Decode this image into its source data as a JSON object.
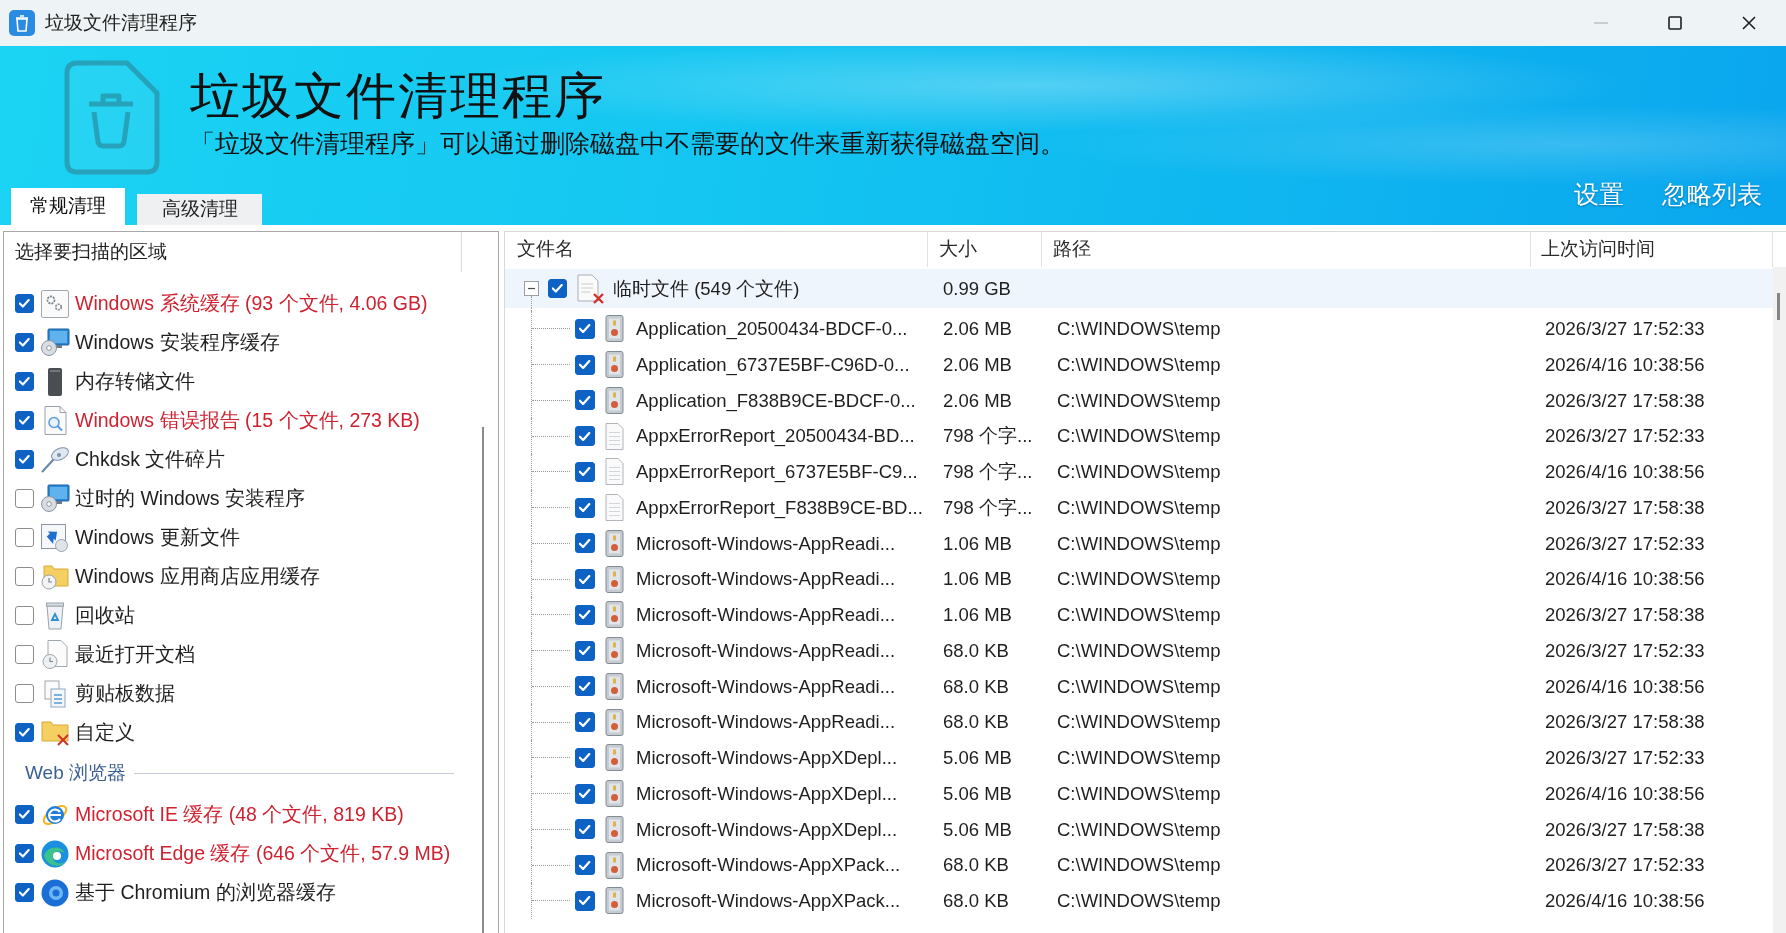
{
  "window": {
    "title": "垃圾文件清理程序"
  },
  "banner": {
    "title": "垃圾文件清理程序",
    "subtitle": "「垃圾文件清理程序」可以通过删除磁盘中不需要的文件来重新获得磁盘空间。"
  },
  "tabs": [
    {
      "label": "常规清理",
      "selected": true
    },
    {
      "label": "高级清理",
      "selected": false
    }
  ],
  "links": [
    "设置",
    "忽略列表"
  ],
  "scan_areas": {
    "header": "选择要扫描的区域",
    "sections": [
      {
        "items": [
          {
            "label": "Windows 系统缓存 (93 个文件, 4.06 GB)",
            "checked": true,
            "has_results": true
          },
          {
            "label": "Windows 安装程序缓存",
            "checked": true,
            "has_results": false
          },
          {
            "label": "内存转储文件",
            "checked": true,
            "has_results": false
          },
          {
            "label": "Windows 错误报告 (15 个文件, 273 KB)",
            "checked": true,
            "has_results": true
          },
          {
            "label": "Chkdsk 文件碎片",
            "checked": true,
            "has_results": false
          },
          {
            "label": "过时的 Windows 安装程序",
            "checked": false,
            "has_results": false
          },
          {
            "label": "Windows 更新文件",
            "checked": false,
            "has_results": false
          },
          {
            "label": "Windows 应用商店应用缓存",
            "checked": false,
            "has_results": false
          },
          {
            "label": "回收站",
            "checked": false,
            "has_results": false
          },
          {
            "label": "最近打开文档",
            "checked": false,
            "has_results": false
          },
          {
            "label": "剪贴板数据",
            "checked": false,
            "has_results": false
          },
          {
            "label": "自定义",
            "checked": true,
            "has_results": false
          }
        ]
      },
      {
        "title": "Web 浏览器",
        "items": [
          {
            "label": "Microsoft IE 缓存 (48 个文件, 819 KB)",
            "checked": true,
            "has_results": true
          },
          {
            "label": "Microsoft Edge 缓存 (646 个文件, 57.9 MB)",
            "checked": true,
            "has_results": true
          },
          {
            "label": "基于 Chromium 的浏览器缓存",
            "checked": true,
            "has_results": false
          }
        ]
      }
    ]
  },
  "file_table": {
    "columns": [
      "文件名",
      "大小",
      "路径",
      "上次访问时间"
    ],
    "groups": [
      {
        "name": "临时文件 (549 个文件)",
        "size": "0.99 GB",
        "checked": true,
        "expanded": true,
        "selected": true,
        "rows": [
          {
            "kind": "binary",
            "checked": true,
            "name": "Application_20500434-BDCF-0...",
            "size": "2.06 MB",
            "path": "C:\\WINDOWS\\temp",
            "accessed": "2026/3/27 17:52:33"
          },
          {
            "kind": "binary",
            "checked": true,
            "name": "Application_6737E5BF-C96D-0...",
            "size": "2.06 MB",
            "path": "C:\\WINDOWS\\temp",
            "accessed": "2026/4/16 10:38:56"
          },
          {
            "kind": "binary",
            "checked": true,
            "name": "Application_F838B9CE-BDCF-0...",
            "size": "2.06 MB",
            "path": "C:\\WINDOWS\\temp",
            "accessed": "2026/3/27 17:58:38"
          },
          {
            "kind": "text",
            "checked": true,
            "name": "AppxErrorReport_20500434-BD...",
            "size": "798 个字...",
            "path": "C:\\WINDOWS\\temp",
            "accessed": "2026/3/27 17:52:33"
          },
          {
            "kind": "text",
            "checked": true,
            "name": "AppxErrorReport_6737E5BF-C9...",
            "size": "798 个字...",
            "path": "C:\\WINDOWS\\temp",
            "accessed": "2026/4/16 10:38:56"
          },
          {
            "kind": "text",
            "checked": true,
            "name": "AppxErrorReport_F838B9CE-BD...",
            "size": "798 个字...",
            "path": "C:\\WINDOWS\\temp",
            "accessed": "2026/3/27 17:58:38"
          },
          {
            "kind": "binary",
            "checked": true,
            "name": "Microsoft-Windows-AppReadi...",
            "size": "1.06 MB",
            "path": "C:\\WINDOWS\\temp",
            "accessed": "2026/3/27 17:52:33"
          },
          {
            "kind": "binary",
            "checked": true,
            "name": "Microsoft-Windows-AppReadi...",
            "size": "1.06 MB",
            "path": "C:\\WINDOWS\\temp",
            "accessed": "2026/4/16 10:38:56"
          },
          {
            "kind": "binary",
            "checked": true,
            "name": "Microsoft-Windows-AppReadi...",
            "size": "1.06 MB",
            "path": "C:\\WINDOWS\\temp",
            "accessed": "2026/3/27 17:58:38"
          },
          {
            "kind": "binary",
            "checked": true,
            "name": "Microsoft-Windows-AppReadi...",
            "size": "68.0 KB",
            "path": "C:\\WINDOWS\\temp",
            "accessed": "2026/3/27 17:52:33"
          },
          {
            "kind": "binary",
            "checked": true,
            "name": "Microsoft-Windows-AppReadi...",
            "size": "68.0 KB",
            "path": "C:\\WINDOWS\\temp",
            "accessed": "2026/4/16 10:38:56"
          },
          {
            "kind": "binary",
            "checked": true,
            "name": "Microsoft-Windows-AppReadi...",
            "size": "68.0 KB",
            "path": "C:\\WINDOWS\\temp",
            "accessed": "2026/3/27 17:58:38"
          },
          {
            "kind": "binary",
            "checked": true,
            "name": "Microsoft-Windows-AppXDepl...",
            "size": "5.06 MB",
            "path": "C:\\WINDOWS\\temp",
            "accessed": "2026/3/27 17:52:33"
          },
          {
            "kind": "binary",
            "checked": true,
            "name": "Microsoft-Windows-AppXDepl...",
            "size": "5.06 MB",
            "path": "C:\\WINDOWS\\temp",
            "accessed": "2026/4/16 10:38:56"
          },
          {
            "kind": "binary",
            "checked": true,
            "name": "Microsoft-Windows-AppXDepl...",
            "size": "5.06 MB",
            "path": "C:\\WINDOWS\\temp",
            "accessed": "2026/3/27 17:58:38"
          },
          {
            "kind": "binary",
            "checked": true,
            "name": "Microsoft-Windows-AppXPack...",
            "size": "68.0 KB",
            "path": "C:\\WINDOWS\\temp",
            "accessed": "2026/3/27 17:52:33"
          },
          {
            "kind": "binary",
            "checked": true,
            "name": "Microsoft-Windows-AppXPack...",
            "size": "68.0 KB",
            "path": "C:\\WINDOWS\\temp",
            "accessed": "2026/4/16 10:38:56"
          }
        ]
      }
    ]
  }
}
